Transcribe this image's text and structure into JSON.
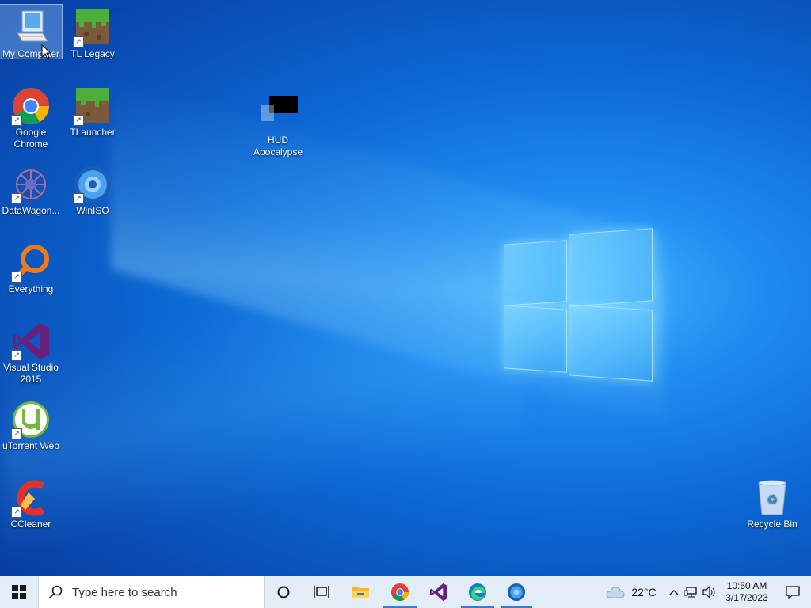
{
  "desktop": {
    "icons": [
      {
        "label": "My Computer",
        "icon": "computer-icon"
      },
      {
        "label": "TL Legacy",
        "icon": "minecraft-grass-icon"
      },
      {
        "label": "Google Chrome",
        "icon": "chrome-icon"
      },
      {
        "label": "TLauncher",
        "icon": "minecraft-grass-icon"
      },
      {
        "label": "HUD Apocalypse",
        "icon": "black-window-icon"
      },
      {
        "label": "DataWagon...",
        "icon": "datawagon-icon"
      },
      {
        "label": "WinISO",
        "icon": "disc-icon"
      },
      {
        "label": "Everything",
        "icon": "magnifier-icon"
      },
      {
        "label": "Visual Studio 2015",
        "icon": "visual-studio-icon"
      },
      {
        "label": "uTorrent Web",
        "icon": "utorrent-icon"
      },
      {
        "label": "CCleaner",
        "icon": "ccleaner-icon"
      },
      {
        "label": "Recycle Bin",
        "icon": "recycle-bin-icon"
      }
    ]
  },
  "taskbar": {
    "search_placeholder": "Type here to search",
    "pinned": [
      "cortana-icon",
      "task-view-icon",
      "file-explorer-icon",
      "chrome-icon",
      "visual-studio-icon",
      "edge-icon",
      "winiso-icon"
    ],
    "weather": {
      "temp": "22°C",
      "icon": "cloud-icon"
    },
    "clock": {
      "time": "10:50 AM",
      "date": "3/17/2023"
    }
  },
  "colors": {
    "accent": "#3b78d8",
    "taskbar_bg": "#e3edf7"
  }
}
